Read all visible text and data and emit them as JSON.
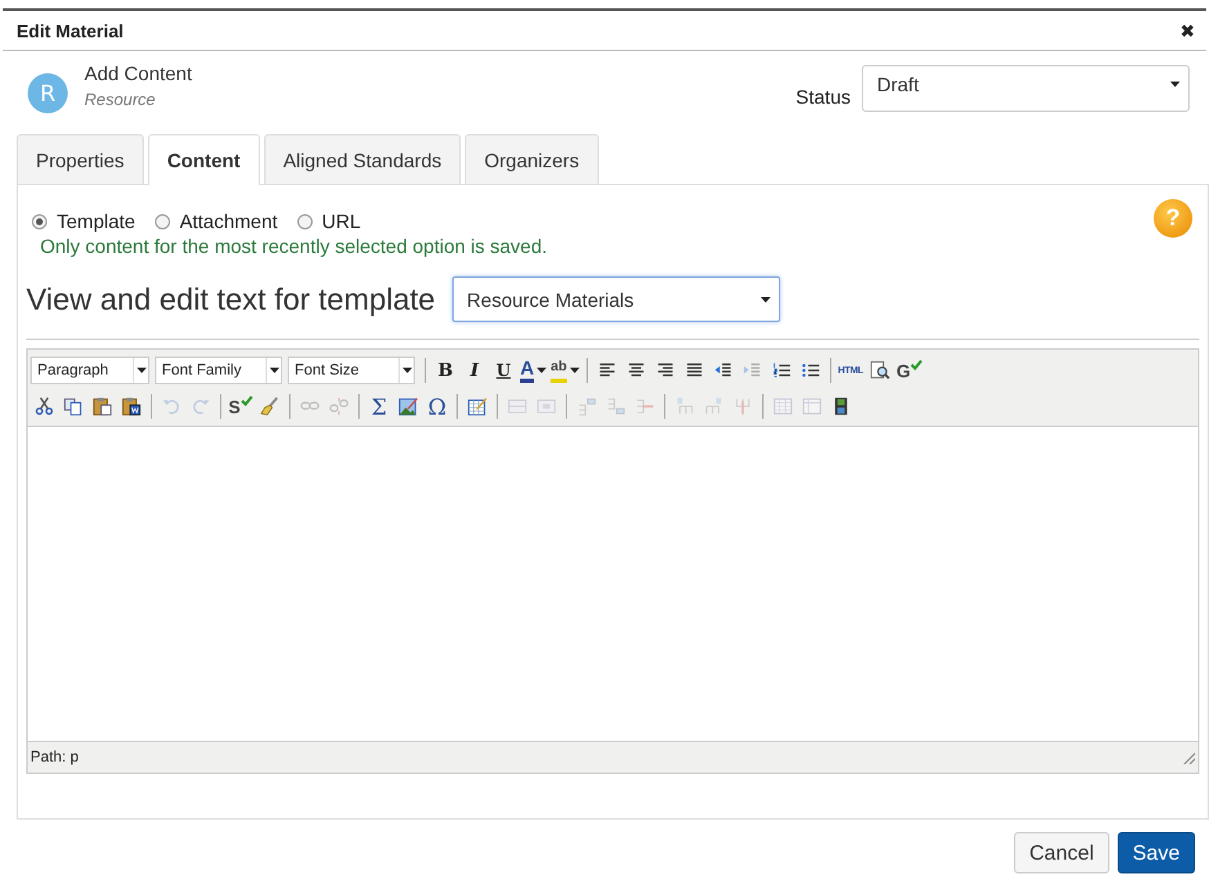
{
  "window": {
    "title": "Edit Material",
    "close": "✖"
  },
  "header": {
    "avatar": "R",
    "title": "Add Content",
    "subtitle": "Resource",
    "status_label": "Status",
    "status_value": "Draft"
  },
  "tabs": [
    {
      "label": "Properties",
      "selected": false
    },
    {
      "label": "Content",
      "selected": true
    },
    {
      "label": "Aligned Standards",
      "selected": false
    },
    {
      "label": "Organizers",
      "selected": false
    }
  ],
  "content_type": [
    {
      "label": "Template",
      "selected": true
    },
    {
      "label": "Attachment",
      "selected": false
    },
    {
      "label": "URL",
      "selected": false
    }
  ],
  "help": "?",
  "note": "Only content for the most recently selected option is saved.",
  "template": {
    "label": "View and edit text for template",
    "value": "Resource Materials"
  },
  "editor": {
    "toolbar_rows": [
      [
        {
          "kind": "select",
          "text": "Paragraph"
        },
        {
          "kind": "select",
          "text": "Font Family"
        },
        {
          "kind": "select",
          "text": "Font Size"
        },
        {
          "kind": "separator"
        },
        {
          "kind": "glyph",
          "text": "B",
          "disabled": false
        },
        {
          "kind": "glyph",
          "text": "I",
          "disabled": false
        },
        {
          "kind": "glyph",
          "text": "U",
          "disabled": false
        },
        {
          "kind": "color",
          "text": "A",
          "color": "#2a3f8f",
          "disabled": false
        },
        {
          "kind": "color",
          "text": "ab",
          "color": "#e6d200",
          "disabled": false
        },
        {
          "kind": "separator"
        },
        {
          "kind": "icon",
          "disabled": false
        },
        {
          "kind": "icon",
          "disabled": false
        },
        {
          "kind": "icon",
          "disabled": false
        },
        {
          "kind": "icon",
          "disabled": false
        },
        {
          "kind": "icon",
          "disabled": false
        },
        {
          "kind": "icon",
          "disabled": true
        },
        {
          "kind": "icon",
          "disabled": false
        },
        {
          "kind": "icon",
          "disabled": false
        },
        {
          "kind": "separator"
        },
        {
          "kind": "glyph",
          "text": "HTML",
          "disabled": false
        },
        {
          "kind": "icon",
          "disabled": false
        },
        {
          "kind": "check",
          "text": "G",
          "disabled": false
        }
      ],
      [
        {
          "kind": "icon",
          "disabled": false
        },
        {
          "kind": "icon",
          "disabled": false
        },
        {
          "kind": "icon",
          "disabled": false
        },
        {
          "kind": "icon",
          "disabled": false
        },
        {
          "kind": "separator"
        },
        {
          "kind": "icon",
          "disabled": true
        },
        {
          "kind": "icon",
          "disabled": true
        },
        {
          "kind": "separator"
        },
        {
          "kind": "check",
          "text": "S",
          "disabled": false
        },
        {
          "kind": "icon",
          "disabled": false
        },
        {
          "kind": "separator"
        },
        {
          "kind": "icon",
          "disabled": true
        },
        {
          "kind": "icon",
          "disabled": true
        },
        {
          "kind": "separator"
        },
        {
          "kind": "glyph",
          "text": "Σ",
          "disabled": false
        },
        {
          "kind": "icon",
          "disabled": false
        },
        {
          "kind": "glyph",
          "text": "Ω",
          "disabled": false
        },
        {
          "kind": "separator"
        },
        {
          "kind": "icon",
          "disabled": false
        },
        {
          "kind": "separator"
        },
        {
          "kind": "icon",
          "disabled": true
        },
        {
          "kind": "icon",
          "disabled": true
        },
        {
          "kind": "separator"
        },
        {
          "kind": "icon",
          "disabled": true
        },
        {
          "kind": "icon",
          "disabled": true
        },
        {
          "kind": "icon",
          "disabled": true
        },
        {
          "kind": "separator"
        },
        {
          "kind": "icon",
          "disabled": true
        },
        {
          "kind": "icon",
          "disabled": true
        },
        {
          "kind": "icon",
          "disabled": true
        },
        {
          "kind": "separator"
        },
        {
          "kind": "icon",
          "disabled": true
        },
        {
          "kind": "icon",
          "disabled": true
        },
        {
          "kind": "icon",
          "disabled": false
        }
      ]
    ],
    "path": "Path: p"
  },
  "buttons": [
    {
      "label": "Cancel",
      "kind": "secondary"
    },
    {
      "label": "Save",
      "kind": "primary"
    }
  ]
}
